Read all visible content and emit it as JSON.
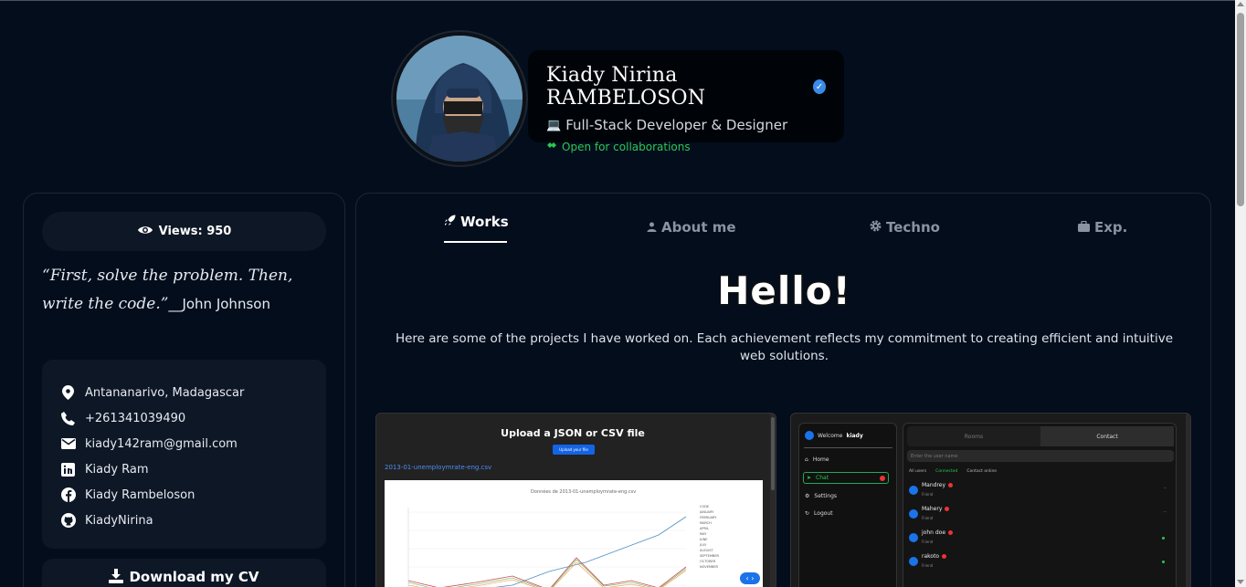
{
  "profile": {
    "name": "Kiady Nirina RAMBELOSON",
    "role": "Full-Stack Developer & Designer",
    "status": "Open for collaborations",
    "verified_icon": "verified-badge-icon",
    "accent_color": "#3b8be6",
    "status_color": "#2dc653"
  },
  "sidebar": {
    "views_label": "Views: 950",
    "quote": "“First, solve the problem. Then, write the code.”",
    "quote_author": "__John Johnson",
    "contacts": [
      {
        "icon": "location-icon",
        "text": "Antananarivo, Madagascar"
      },
      {
        "icon": "phone-icon",
        "text": "+261341039490"
      },
      {
        "icon": "mail-icon",
        "text": "kiady142ram@gmail.com"
      },
      {
        "icon": "linkedin-icon",
        "text": "Kiady Ram"
      },
      {
        "icon": "facebook-icon",
        "text": "Kiady Rambeloson"
      },
      {
        "icon": "github-icon",
        "text": "KiadyNirina"
      }
    ],
    "download_label": "Download my CV"
  },
  "tabs": [
    {
      "label": "Works",
      "icon": "rocket-icon",
      "active": true
    },
    {
      "label": "About me",
      "icon": "user-icon",
      "active": false
    },
    {
      "label": "Techno",
      "icon": "gear-icon",
      "active": false
    },
    {
      "label": "Exp.",
      "icon": "briefcase-icon",
      "active": false
    }
  ],
  "main": {
    "hello": "Hello!",
    "intro": "Here are some of the projects I have worked on. Each achievement reflects my commitment to creating efficient and intuitive web solutions."
  },
  "project1": {
    "title": "Upload a JSON or CSV file",
    "button": "Upload your file",
    "file": "2013-01-unemploymrate-eng.csv"
  },
  "project2": {
    "welcome": "Welcome",
    "user": "kiady",
    "menu": [
      "Home",
      "Chat",
      "Settings",
      "Logout"
    ],
    "tabs": [
      "Rooms",
      "Contact"
    ],
    "search_placeholder": "Enter the user name",
    "filters": [
      "All users",
      "Connected",
      "Contact online"
    ],
    "contacts": [
      {
        "name": "Mandrey",
        "sub": "Friend"
      },
      {
        "name": "Mahery",
        "sub": "Friend"
      },
      {
        "name": "john doe",
        "sub": "Friend"
      },
      {
        "name": "rakoto",
        "sub": "Friend"
      }
    ]
  }
}
